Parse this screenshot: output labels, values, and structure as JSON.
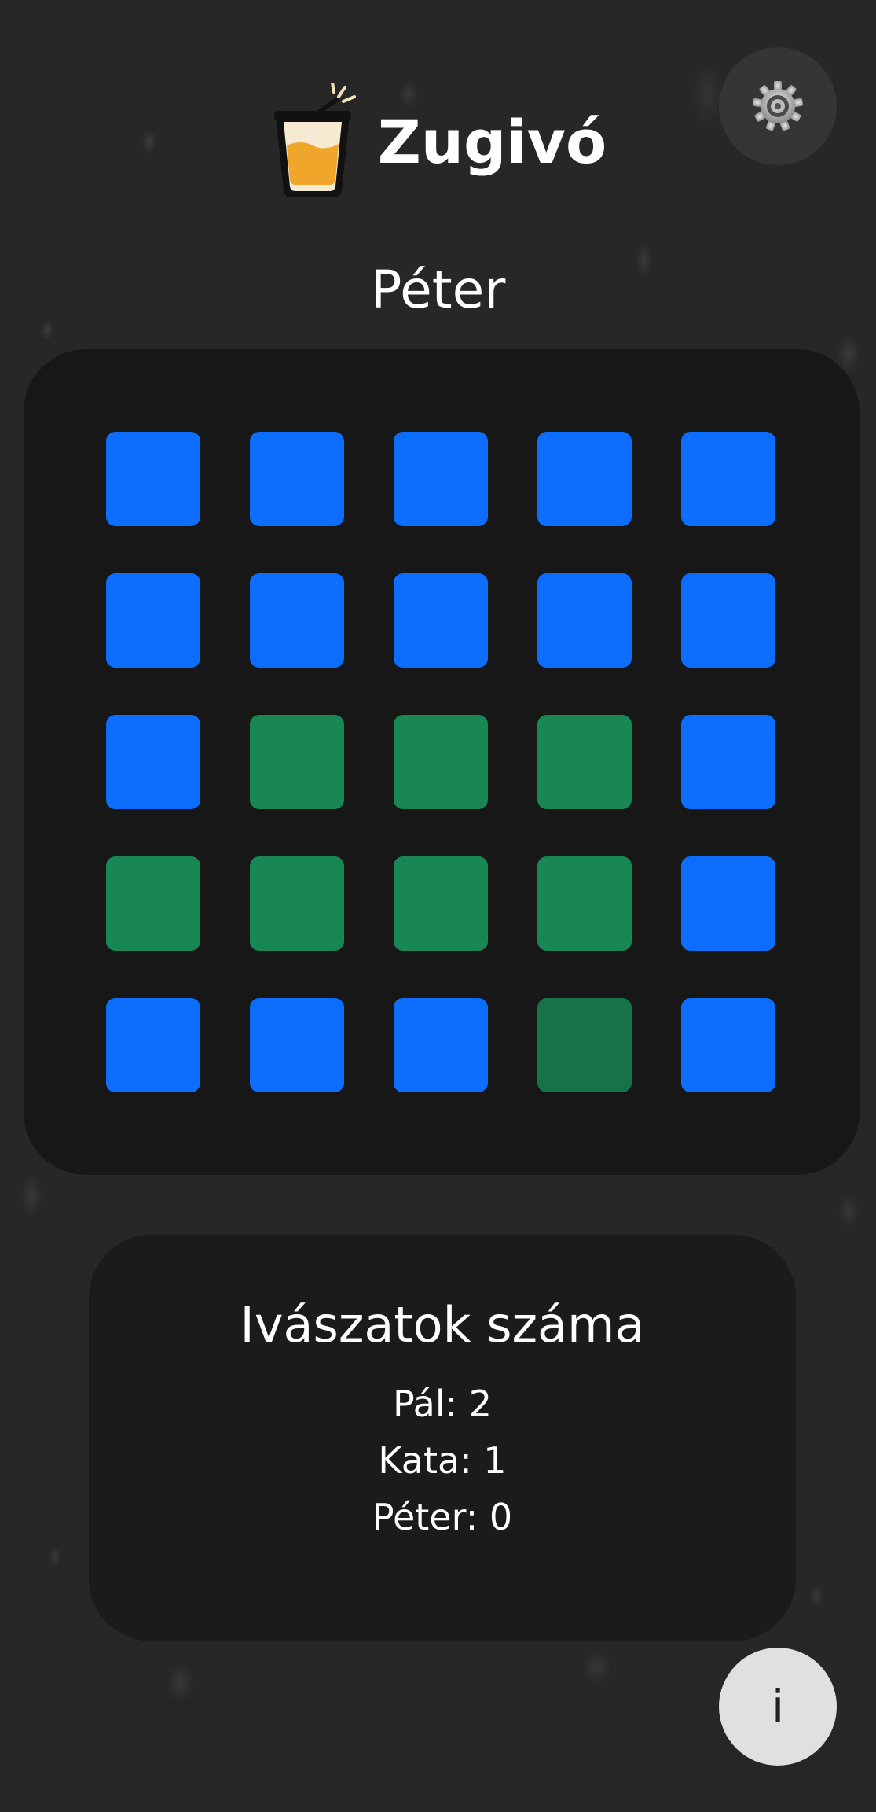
{
  "app": {
    "title": "Zugivó",
    "logo_icon": "shot-glass-icon",
    "settings_icon": "gear-icon"
  },
  "player": {
    "current_name": "Péter"
  },
  "board": {
    "rows": 5,
    "cols": 5,
    "colors": {
      "hidden": "#0d6efd",
      "revealed": "#198754",
      "revealed_dark": "#157347"
    },
    "tiles": [
      [
        "hidden",
        "hidden",
        "hidden",
        "hidden",
        "hidden"
      ],
      [
        "hidden",
        "hidden",
        "hidden",
        "hidden",
        "hidden"
      ],
      [
        "hidden",
        "revealed",
        "revealed",
        "revealed",
        "hidden"
      ],
      [
        "revealed",
        "revealed",
        "revealed",
        "revealed",
        "hidden"
      ],
      [
        "hidden",
        "hidden",
        "hidden",
        "revealed_dark",
        "hidden"
      ]
    ]
  },
  "stats": {
    "title": "Ivászatok száma",
    "entries": [
      {
        "text": "Pál: 2"
      },
      {
        "text": "Kata: 1"
      },
      {
        "text": "Péter: 0"
      }
    ]
  },
  "info_button": {
    "label": "i"
  }
}
